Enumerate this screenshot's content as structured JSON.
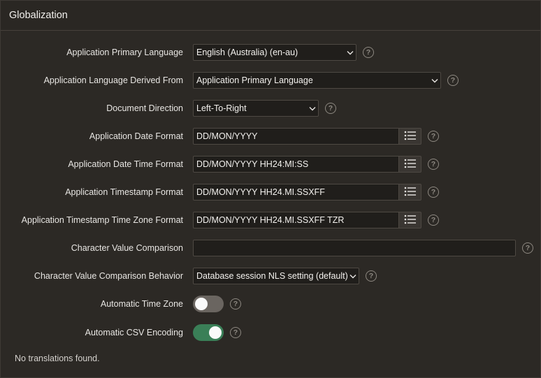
{
  "panel": {
    "title": "Globalization"
  },
  "fields": {
    "primary_language": {
      "label": "Application Primary Language",
      "value": "English (Australia) (en-au)"
    },
    "language_derived_from": {
      "label": "Application Language Derived From",
      "value": "Application Primary Language"
    },
    "document_direction": {
      "label": "Document Direction",
      "value": "Left-To-Right"
    },
    "date_format": {
      "label": "Application Date Format",
      "value": "DD/MON/YYYY"
    },
    "date_time_format": {
      "label": "Application Date Time Format",
      "value": "DD/MON/YYYY HH24:MI:SS"
    },
    "timestamp_format": {
      "label": "Application Timestamp Format",
      "value": "DD/MON/YYYY HH24.MI.SSXFF"
    },
    "timestamp_tz_format": {
      "label": "Application Timestamp Time Zone Format",
      "value": "DD/MON/YYYY HH24.MI.SSXFF TZR"
    },
    "char_value_comparison": {
      "label": "Character Value Comparison",
      "value": ""
    },
    "char_value_comparison_behavior": {
      "label": "Character Value Comparison Behavior",
      "value": "Database session NLS setting (default)"
    },
    "auto_time_zone": {
      "label": "Automatic Time Zone",
      "state": "off"
    },
    "auto_csv_encoding": {
      "label": "Automatic CSV Encoding",
      "state": "on"
    }
  },
  "help_glyph": "?",
  "footer": {
    "note": "No translations found."
  },
  "colors": {
    "background": "#2c2925",
    "toggle_on": "#3a7f57",
    "toggle_off": "#6a6560"
  },
  "icons": {
    "dropdown": "chevron-down-icon",
    "list_of_values": "list-icon",
    "help": "help-icon"
  }
}
